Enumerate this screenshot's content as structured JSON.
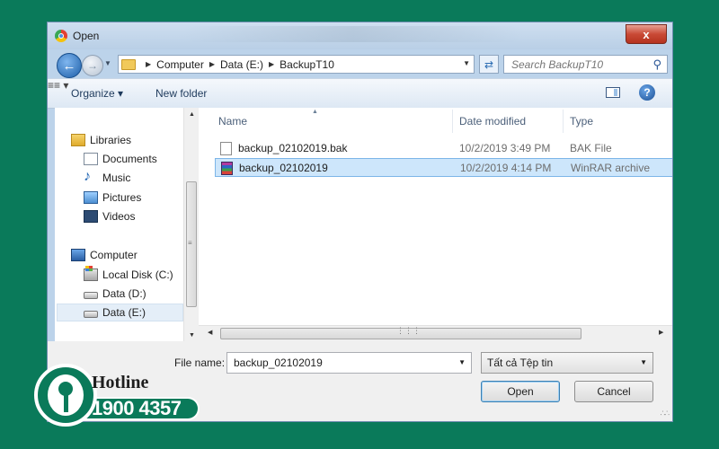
{
  "window": {
    "title": "Open",
    "close_label": "x"
  },
  "address": {
    "crumbs": [
      "Computer",
      "Data (E:)",
      "BackupT10"
    ]
  },
  "search": {
    "placeholder": "Search BackupT10"
  },
  "toolbar": {
    "organize": "Organize ▾",
    "new_folder": "New folder"
  },
  "sidebar": {
    "libraries": "Libraries",
    "library_items": [
      "Documents",
      "Music",
      "Pictures",
      "Videos"
    ],
    "computer": "Computer",
    "drives": [
      "Local Disk (C:)",
      "Data (D:)",
      "Data (E:)"
    ],
    "selected_drive": "Data (E:)"
  },
  "columns": {
    "name": "Name",
    "date": "Date modified",
    "type": "Type"
  },
  "files": [
    {
      "name": "backup_02102019.bak",
      "date": "10/2/2019 3:49 PM",
      "type": "BAK File",
      "icon": "bak-file-icon",
      "selected": false
    },
    {
      "name": "backup_02102019",
      "date": "10/2/2019 4:14 PM",
      "type": "WinRAR archive",
      "icon": "winrar-icon",
      "selected": true
    }
  ],
  "filename": {
    "label": "File name:",
    "value": "backup_02102019"
  },
  "filetype": {
    "value": "Tất cả Tệp tin"
  },
  "buttons": {
    "open": "Open",
    "cancel": "Cancel"
  },
  "hotline": {
    "title": "Hotline",
    "number": "1900 4357"
  },
  "colors": {
    "background": "#0a7a5a",
    "selection": "#cde6fb"
  }
}
